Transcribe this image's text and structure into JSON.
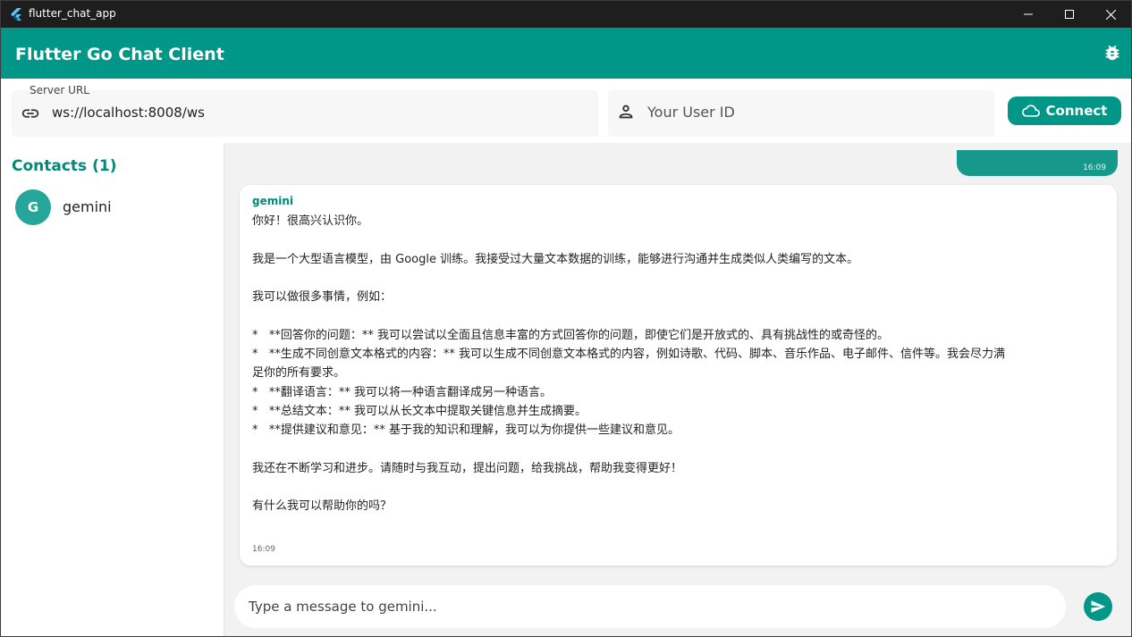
{
  "window": {
    "title": "flutter_chat_app"
  },
  "appbar": {
    "title": "Flutter Go Chat Client",
    "debug_icon": "bug-report-icon"
  },
  "connection": {
    "server_label": "Server URL",
    "server_value": "ws://localhost:8008/ws",
    "user_id_placeholder": "Your User ID",
    "connect_label": "Connect"
  },
  "sidebar": {
    "title": "Contacts (1)",
    "contacts": [
      {
        "initial": "G",
        "name": "gemini"
      }
    ]
  },
  "chat": {
    "sent": {
      "time": "16:09"
    },
    "received": {
      "sender": "gemini",
      "lines": [
        "你好！很高兴认识你。",
        "",
        "我是一个大型语言模型，由 Google 训练。我接受过大量文本数据的训练，能够进行沟通并生成类似人类编写的文本。",
        "",
        "我可以做很多事情，例如：",
        "",
        "*   **回答你的问题：** 我可以尝试以全面且信息丰富的方式回答你的问题，即使它们是开放式的、具有挑战性的或奇怪的。",
        "*   **生成不同创意文本格式的内容：** 我可以生成不同创意文本格式的内容，例如诗歌、代码、脚本、音乐作品、电子邮件、信件等。我会尽力满",
        "足你的所有要求。",
        "*   **翻译语言：** 我可以将一种语言翻译成另一种语言。",
        "*   **总结文本：** 我可以从长文本中提取关键信息并生成摘要。",
        "*   **提供建议和意见：** 基于我的知识和理解，我可以为你提供一些建议和意见。",
        "",
        "我还在不断学习和进步。请随时与我互动，提出问题，给我挑战，帮助我变得更好！",
        "",
        "有什么我可以帮助你的吗？"
      ],
      "time": "16:09"
    },
    "input_placeholder": "Type a message to gemini..."
  },
  "colors": {
    "primary": "#009688",
    "accent_text": "#00897b",
    "avatar": "#26a69a",
    "titlebar": "#1e1e1e"
  }
}
